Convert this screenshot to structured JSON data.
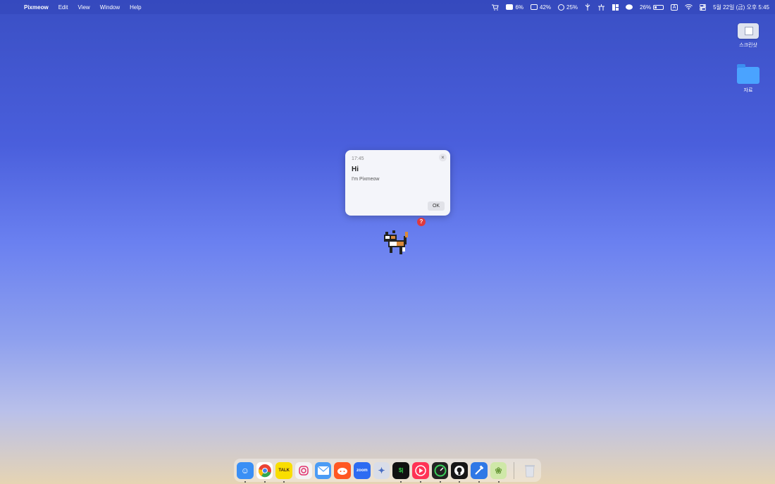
{
  "menubar": {
    "app_name": "Pixmeow",
    "menus": [
      "Edit",
      "View",
      "Window",
      "Help"
    ],
    "status": {
      "cpu_percent": "6%",
      "memory_percent": "42%",
      "disk_percent": "25%",
      "battery_percent": "26%",
      "input_letter": "A",
      "datetime": "5월 22일 (금) 오후 5:45"
    }
  },
  "desktop": {
    "icons": [
      {
        "label": "스크린샷"
      },
      {
        "label": "자료"
      }
    ]
  },
  "dialog": {
    "time": "17:45",
    "title": "Hi",
    "message": "I'm Pixmeow",
    "ok_label": "OK",
    "close_glyph": "×"
  },
  "badge": "?",
  "dock": {
    "apps": [
      {
        "name": "finder",
        "color": "#3a8ff5",
        "label": "",
        "running": true
      },
      {
        "name": "chrome",
        "color": "#ffffff",
        "label": "",
        "running": true
      },
      {
        "name": "kakaotalk",
        "color": "#f9de00",
        "label": "TALK",
        "running": true
      },
      {
        "name": "instagram",
        "color": "#f3f3f3",
        "label": "",
        "running": false
      },
      {
        "name": "mail",
        "color": "#4b9cf5",
        "label": "",
        "running": false
      },
      {
        "name": "reddit",
        "color": "#ff5722",
        "label": "",
        "running": false
      },
      {
        "name": "zoom",
        "color": "#2d6cf2",
        "label": "zoom",
        "running": false
      },
      {
        "name": "perplexity",
        "color": "#d9dde8",
        "label": "",
        "running": false
      },
      {
        "name": "terminal",
        "color": "#111111",
        "label": "$|",
        "running": true
      },
      {
        "name": "youtube-music",
        "color": "#ff3355",
        "label": "",
        "running": true
      },
      {
        "name": "activity-monitor",
        "color": "#222222",
        "label": "",
        "running": true
      },
      {
        "name": "github",
        "color": "#161616",
        "label": "",
        "running": true
      },
      {
        "name": "xcode",
        "color": "#2f78e6",
        "label": "",
        "running": true
      },
      {
        "name": "pixmeow",
        "color": "#cfe8a8",
        "label": "",
        "running": true
      }
    ],
    "trash": {
      "name": "trash"
    }
  }
}
